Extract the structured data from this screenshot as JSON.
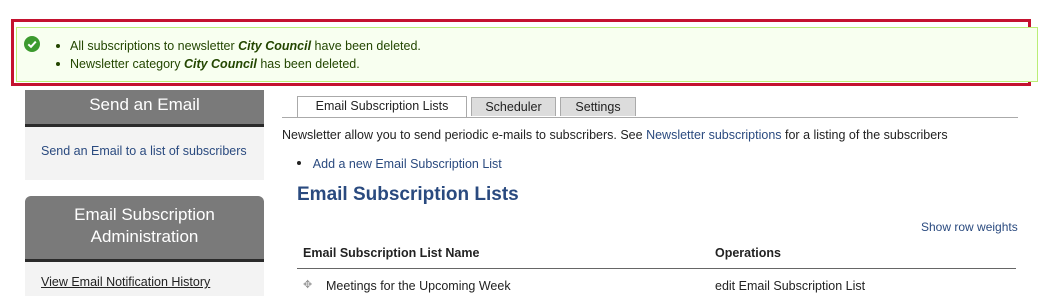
{
  "status": {
    "messages": [
      {
        "before": "All subscriptions to newsletter ",
        "emph": "City Council",
        "after": " have been deleted."
      },
      {
        "before": "Newsletter category ",
        "emph": "City Council",
        "after": " has been deleted."
      }
    ],
    "icon": "check-circle-icon"
  },
  "sidebar": {
    "send_email": {
      "title": "Send an Email",
      "link": "Send an Email to a list of subscribers"
    },
    "admin": {
      "title_line1": "Email Subscription",
      "title_line2": "Administration",
      "link": "View Email Notification History"
    }
  },
  "tabs": [
    {
      "label": "Email Subscription Lists",
      "active": true
    },
    {
      "label": "Scheduler",
      "active": false
    },
    {
      "label": "Settings",
      "active": false
    }
  ],
  "intro": {
    "before": "Newsletter allow you to send periodic e-mails to subscribers. See ",
    "link": "Newsletter subscriptions",
    "after": " for a listing of the subscribers"
  },
  "add_link": "Add a new Email Subscription List",
  "page_title": "Email Subscription Lists",
  "row_weights": "Show row weights",
  "table": {
    "headers": [
      "Email Subscription List Name",
      "Operations"
    ],
    "rows": [
      {
        "name": "Meetings for the Upcoming Week",
        "operation": "edit Email Subscription List"
      }
    ]
  },
  "colors": {
    "highlight_border": "#c4122f",
    "status_bg": "#f8fff0",
    "status_icon": "#3c9a2e",
    "link": "#2a4a7f",
    "sidebar_header": "#7a7a7a"
  }
}
